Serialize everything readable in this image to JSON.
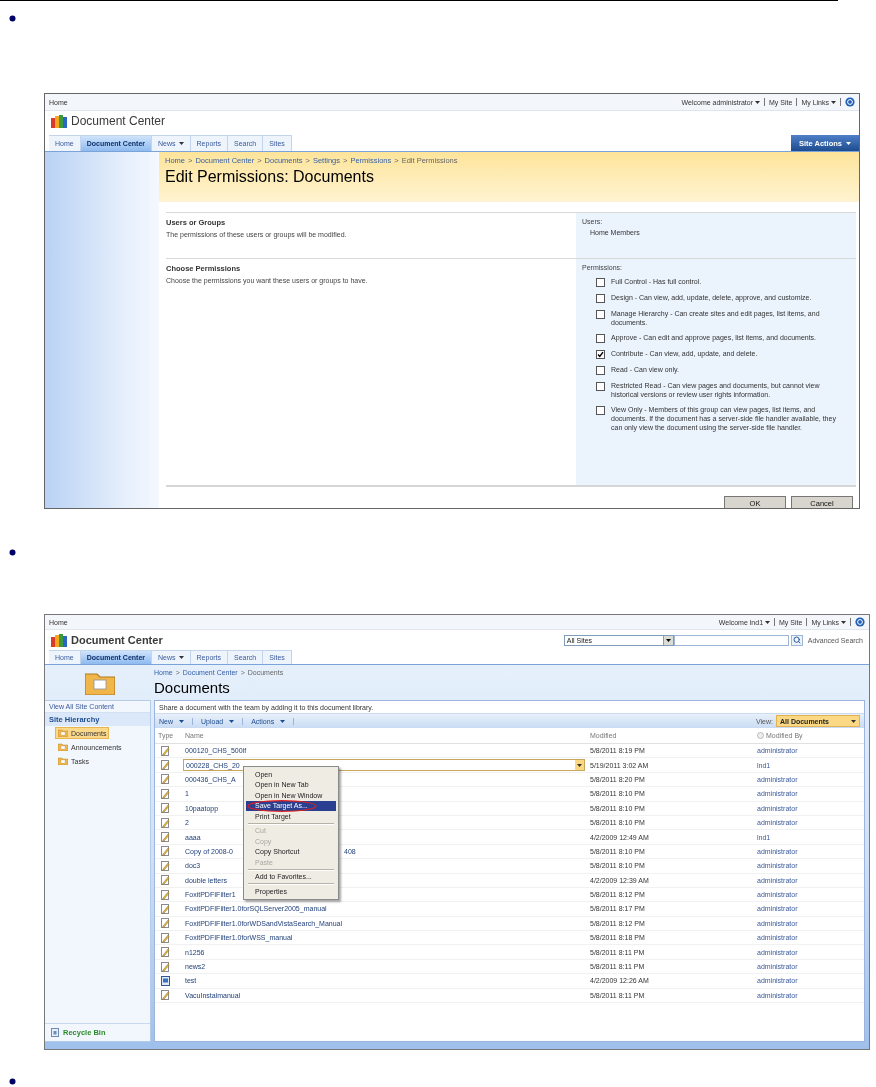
{
  "screenshot_1": {
    "top_bar": {
      "home": "Home",
      "welcome": "Welcome administrator",
      "my_site": "My Site",
      "my_links": "My Links"
    },
    "site_title": "Document Center",
    "tabs": [
      {
        "label": "Home",
        "selected": false,
        "has_menu": false
      },
      {
        "label": "Document Center",
        "selected": true,
        "has_menu": false
      },
      {
        "label": "News",
        "selected": false,
        "has_menu": true
      },
      {
        "label": "Reports",
        "selected": false,
        "has_menu": false
      },
      {
        "label": "Search",
        "selected": false,
        "has_menu": false
      },
      {
        "label": "Sites",
        "selected": false,
        "has_menu": false
      }
    ],
    "site_actions": "Site Actions",
    "breadcrumb": [
      {
        "label": "Home",
        "separator": ">"
      },
      {
        "label": "Document Center",
        "separator": ">"
      },
      {
        "label": "Documents",
        "separator": ">"
      },
      {
        "label": "Settings",
        "separator": ">"
      },
      {
        "label": "Permissions",
        "separator": ">"
      },
      {
        "label": "Edit Permissions"
      }
    ],
    "page_title": "Edit Permissions: Documents",
    "sections": [
      {
        "kind": "users",
        "title": "Users or Groups",
        "description": "The permissions of these users or groups will be modified.",
        "field_label": "Users:",
        "values": [
          "Home Members"
        ]
      },
      {
        "kind": "permissions",
        "title": "Choose Permissions",
        "description": "Choose the permissions you want these users or groups to have.",
        "field_label": "Permissions:",
        "permissions": [
          {
            "label": "Full Control - Has full control.",
            "checked": false
          },
          {
            "label": "Design - Can view, add, update, delete, approve, and customize.",
            "checked": false
          },
          {
            "label": "Manage Hierarchy - Can create sites and edit pages, list items, and documents.",
            "checked": false
          },
          {
            "label": "Approve - Can edit and approve pages, list items, and documents.",
            "checked": false
          },
          {
            "label": "Contribute - Can view, add, update, and delete.",
            "checked": true
          },
          {
            "label": "Read - Can view only.",
            "checked": false
          },
          {
            "label": "Restricted Read - Can view pages and documents, but cannot view historical versions or review user rights information.",
            "checked": false
          },
          {
            "label": "View Only - Members of this group can view pages, list items, and documents. If the document has a server-side file handler available, they can only view the document using the server-side file handler.",
            "checked": false
          }
        ]
      }
    ],
    "buttons": [
      "OK",
      "Cancel"
    ]
  },
  "screenshot_2": {
    "top_bar": {
      "home": "Home",
      "welcome": "Welcome lnd1",
      "my_site": "My Site",
      "my_links": "My Links"
    },
    "site_title": "Document Center",
    "search": {
      "scope": "All Sites",
      "advanced": "Advanced Search"
    },
    "tabs": [
      {
        "label": "Home",
        "selected": false,
        "has_menu": false
      },
      {
        "label": "Document Center",
        "selected": true,
        "has_menu": false
      },
      {
        "label": "News",
        "selected": false,
        "has_menu": true
      },
      {
        "label": "Reports",
        "selected": false,
        "has_menu": false
      },
      {
        "label": "Search",
        "selected": false,
        "has_menu": false
      },
      {
        "label": "Sites",
        "selected": false,
        "has_menu": false
      }
    ],
    "breadcrumb": [
      {
        "label": "Home",
        "separator": ">"
      },
      {
        "label": "Document Center",
        "separator": ">"
      },
      {
        "label": "Documents"
      }
    ],
    "page_title": "Documents",
    "nav": {
      "view_all": "View All Site Content",
      "heading": "Site Hierarchy",
      "items": [
        {
          "label": "Documents",
          "selected": true
        },
        {
          "label": "Announcements",
          "selected": false
        },
        {
          "label": "Tasks",
          "selected": false
        }
      ],
      "recycle_bin": "Recycle Bin"
    },
    "description": "Share a document with the team by adding it to this document library.",
    "toolbar": [
      {
        "label": "New"
      },
      {
        "label": "Upload"
      },
      {
        "label": "Actions"
      }
    ],
    "view": {
      "label": "View:",
      "value": "All Documents"
    },
    "columns": [
      "Type",
      "Name",
      "Modified",
      "Modified By"
    ],
    "rows": [
      {
        "kind": "document",
        "name": "000120_CHS_500lf",
        "modified": "5/8/2011 8:19 PM",
        "modified_by": "administrator",
        "hovered": false
      },
      {
        "kind": "document",
        "name": "000228_CHS_20",
        "modified": "5/19/2011 3:02 AM",
        "modified_by": "lnd1",
        "hovered": true
      },
      {
        "kind": "document",
        "name": "000436_CHS_A",
        "modified": "5/8/2011 8:20 PM",
        "modified_by": "administrator",
        "hovered": false
      },
      {
        "kind": "document",
        "name": "1",
        "modified": "5/8/2011 8:10 PM",
        "modified_by": "administrator",
        "hovered": false
      },
      {
        "kind": "document",
        "name": "10paatopp",
        "modified": "5/8/2011 8:10 PM",
        "modified_by": "administrator",
        "hovered": false
      },
      {
        "kind": "document",
        "name": "2",
        "modified": "5/8/2011 8:10 PM",
        "modified_by": "administrator",
        "hovered": false
      },
      {
        "kind": "document",
        "name": "aaaa",
        "modified": "4/2/2009 12:49 AM",
        "modified_by": "lnd1",
        "hovered": false
      },
      {
        "kind": "document",
        "name": "Copy of 2008-0",
        "name_tail": "408",
        "modified": "5/8/2011 8:10 PM",
        "modified_by": "administrator",
        "hovered": false
      },
      {
        "kind": "document",
        "name": "doc3",
        "modified": "5/8/2011 8:10 PM",
        "modified_by": "administrator",
        "hovered": false
      },
      {
        "kind": "document",
        "name": "double letters",
        "modified": "4/2/2009 12:39 AM",
        "modified_by": "administrator",
        "hovered": false
      },
      {
        "kind": "document",
        "name": "FoxitPDFIFilter1",
        "modified": "5/8/2011 8:12 PM",
        "modified_by": "administrator",
        "hovered": false
      },
      {
        "kind": "document",
        "name": "FoxitPDFIFilter1.0forSQLServer2005_manual",
        "modified": "5/8/2011 8:17 PM",
        "modified_by": "administrator",
        "hovered": false
      },
      {
        "kind": "document",
        "name": "FoxitPDFIFilter1.0forWDSandVistaSearch_Manual",
        "modified": "5/8/2011 8:12 PM",
        "modified_by": "administrator",
        "hovered": false
      },
      {
        "kind": "document",
        "name": "FoxitPDFIFilter1.0forWSS_manual",
        "modified": "5/8/2011 8:18 PM",
        "modified_by": "administrator",
        "hovered": false
      },
      {
        "kind": "document",
        "name": "n1256",
        "modified": "5/8/2011 8:11 PM",
        "modified_by": "administrator",
        "hovered": false
      },
      {
        "kind": "document",
        "name": "news2",
        "modified": "5/8/2011 8:11 PM",
        "modified_by": "administrator",
        "hovered": false
      },
      {
        "kind": "page",
        "name": "test",
        "modified": "4/2/2009 12:26 AM",
        "modified_by": "administrator",
        "hovered": false
      },
      {
        "kind": "document",
        "name": "VacuInstalmanual",
        "modified": "5/8/2011 8:11 PM",
        "modified_by": "administrator",
        "hovered": false
      }
    ],
    "context_menu": [
      {
        "kind": "item",
        "label": "Open",
        "disabled": false,
        "selected": false
      },
      {
        "kind": "item",
        "label": "Open in New Tab",
        "disabled": false,
        "selected": false
      },
      {
        "kind": "item",
        "label": "Open in New Window",
        "disabled": false,
        "selected": false
      },
      {
        "kind": "item",
        "label": "Save Target As...",
        "disabled": false,
        "selected": true
      },
      {
        "kind": "item",
        "label": "Print Target",
        "disabled": false,
        "selected": false
      },
      {
        "kind": "separator"
      },
      {
        "kind": "item",
        "label": "Cut",
        "disabled": true,
        "selected": false
      },
      {
        "kind": "item",
        "label": "Copy",
        "disabled": true,
        "selected": false
      },
      {
        "kind": "item",
        "label": "Copy Shortcut",
        "disabled": false,
        "selected": false
      },
      {
        "kind": "item",
        "label": "Paste",
        "disabled": true,
        "selected": false
      },
      {
        "kind": "separator"
      },
      {
        "kind": "item",
        "label": "Add to Favorites...",
        "disabled": false,
        "selected": false
      },
      {
        "kind": "separator"
      },
      {
        "kind": "item",
        "label": "Properties",
        "disabled": false,
        "selected": false
      }
    ]
  }
}
